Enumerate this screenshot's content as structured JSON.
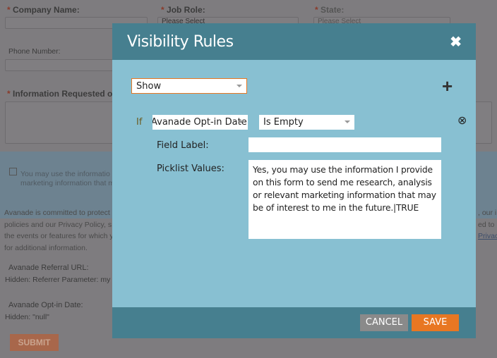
{
  "background_form": {
    "company_name": "Company Name:",
    "job_role": "Job Role:",
    "job_role_value": "Please Select",
    "state": "State:",
    "state_value": "Please Select",
    "phone": "Phone Number:",
    "info_requested": "Information Requested or",
    "consent_text_1": "You may use the informatio",
    "consent_text_2": "marketing information that m",
    "privacy_1": "Avanade is committed to protect",
    "privacy_2": "policies and our Privacy Policy, s",
    "privacy_3": "the events or features for which y",
    "privacy_4": "for additional information.",
    "privacy_r1": ", our i",
    "privacy_r2": "ed to",
    "privacy_r3": "Privac",
    "referral_label": "Avanade Referral URL:",
    "referral_hidden": "Hidden: Referrer Parameter: my",
    "optin_label": "Avanade Opt-in Date:",
    "optin_hidden": "Hidden: \"null\"",
    "submit": "SUBMIT",
    "required_mark": "*"
  },
  "modal": {
    "title": "Visibility Rules",
    "close": "✖",
    "action_select": "Show",
    "add": "+",
    "if_label": "If",
    "field_select": "Avanade Opt-in Date",
    "operator_select": "Is Empty",
    "remove": "⊗",
    "field_label_label": "Field Label:",
    "field_label_value": "",
    "picklist_label": "Picklist Values:",
    "picklist_value": "Yes, you may use the information I provide on this form to send me research, analysis or relevant marketing information that may be of interest to me in the future.|TRUE",
    "cancel": "CANCEL",
    "save": "SAVE"
  },
  "colors": {
    "header": "#467f8f",
    "body": "#88c0d2",
    "save": "#e87722",
    "cancel": "#8a8a8a"
  }
}
